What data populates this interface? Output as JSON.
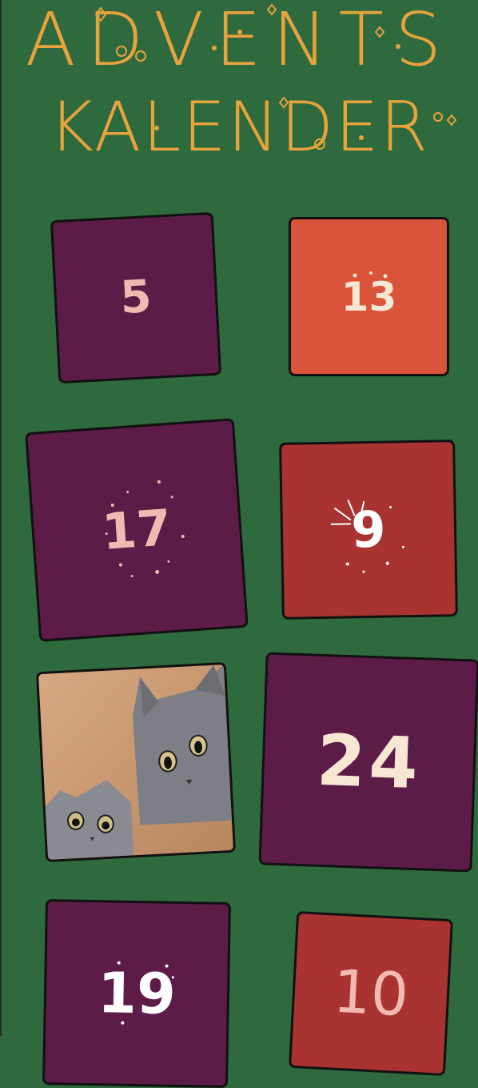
{
  "header": {
    "line1": "ADVENTS",
    "line2": "KALENDER"
  },
  "doors": [
    {
      "number": "5"
    },
    {
      "number": "13"
    },
    {
      "number": "17"
    },
    {
      "number": "9"
    },
    {
      "number": "24"
    },
    {
      "number": "19"
    },
    {
      "number": "10"
    }
  ],
  "colors": {
    "background": "#2f6a3f",
    "title": "#e8a33c",
    "plum": "#5d1c47",
    "coral": "#da533b",
    "brick": "#a83331",
    "number_pink": "#f2b9b3",
    "number_cream": "#f7e7d2"
  }
}
